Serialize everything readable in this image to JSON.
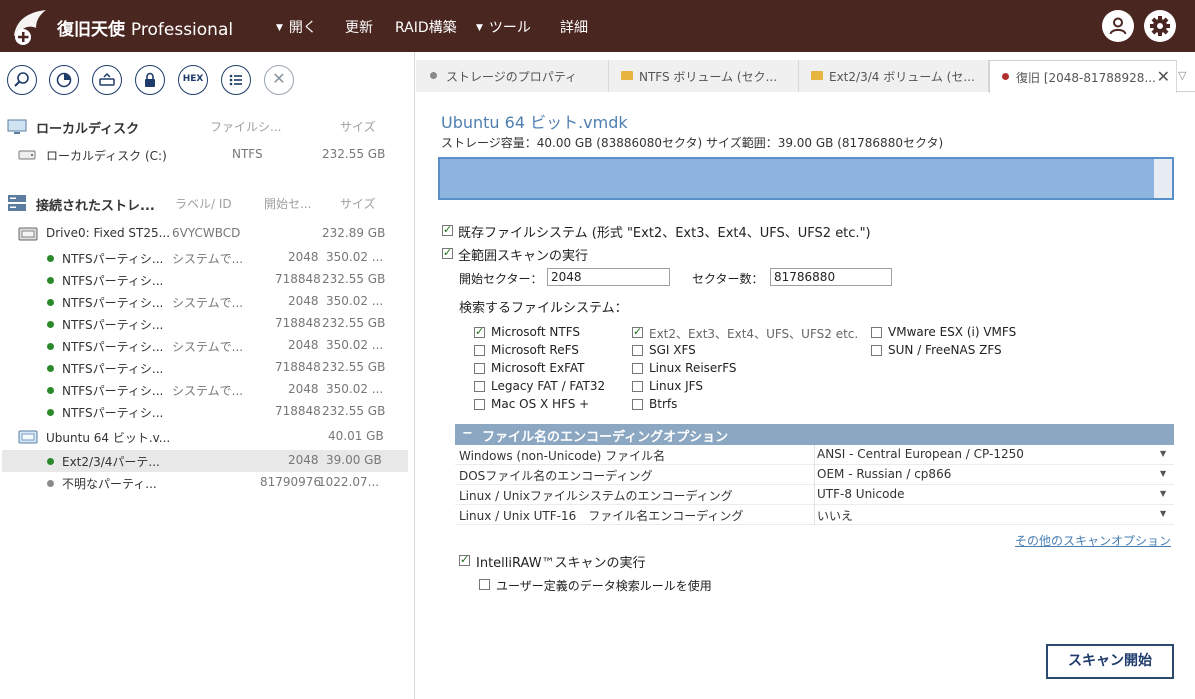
{
  "app": {
    "title_main": "復旧天使",
    "title_suffix": "Professional",
    "menu": [
      {
        "label": "開く",
        "caret": true
      },
      {
        "label": "更新",
        "caret": false
      },
      {
        "label": "RAID構築",
        "caret": false
      },
      {
        "label": "ツール",
        "caret": true
      },
      {
        "label": "詳細",
        "caret": false
      }
    ],
    "toolbar_hex": "HEX",
    "toolbar_close": "✕"
  },
  "left": {
    "local_section": {
      "title": "ローカルディスク",
      "col_fs": "ファイルシ...",
      "col_size": "サイズ"
    },
    "local_disk": {
      "name": "ローカルディスク (C:)",
      "fs": "NTFS",
      "size": "232.55 GB"
    },
    "connected_section": {
      "title": "接続されたストレ...",
      "col_label": "ラベル/ ID",
      "col_start": "開始セ...",
      "col_size": "サイズ"
    },
    "drive0": {
      "name": "Drive0: Fixed ST25...",
      "id": "6VYCWBCD",
      "size": "232.89 GB"
    },
    "partitions": [
      {
        "name": "NTFSパーティシ...",
        "label": "システムで...",
        "start": "2048",
        "size": "350.02 ..."
      },
      {
        "name": "NTFSパーティシ...",
        "label": "",
        "start": "718848",
        "size": "232.55 GB"
      },
      {
        "name": "NTFSパーティシ...",
        "label": "システムで...",
        "start": "2048",
        "size": "350.02 ..."
      },
      {
        "name": "NTFSパーティシ...",
        "label": "",
        "start": "718848",
        "size": "232.55 GB"
      },
      {
        "name": "NTFSパーティシ...",
        "label": "システムで...",
        "start": "2048",
        "size": "350.02 ..."
      },
      {
        "name": "NTFSパーティシ...",
        "label": "",
        "start": "718848",
        "size": "232.55 GB"
      },
      {
        "name": "NTFSパーティシ...",
        "label": "システムで...",
        "start": "2048",
        "size": "350.02 ..."
      },
      {
        "name": "NTFSパーティシ...",
        "label": "",
        "start": "718848",
        "size": "232.55 GB"
      }
    ],
    "vmdk": {
      "name": "Ubuntu 64 ビット.v...",
      "size": "40.01 GB"
    },
    "vmdk_parts": [
      {
        "name": "Ext2/3/4パーテ...",
        "start": "2048",
        "size": "39.00 GB"
      },
      {
        "name": "不明なパーティ...",
        "start": "81790976",
        "size": "1022.07..."
      }
    ]
  },
  "tabs": [
    {
      "label": "ストレージのプロパティ",
      "icon": "dot-icon"
    },
    {
      "label": "NTFS ボリューム (セク...",
      "icon": "folder-icon"
    },
    {
      "label": "Ext2/3/4 ボリューム (セ...",
      "icon": "folder-icon"
    },
    {
      "label": "復旧 [2048-81788928...",
      "icon": "red-dot-icon"
    }
  ],
  "tab_close": "✕",
  "tab_dropdown": "▽",
  "main": {
    "title": "Ubuntu 64 ビット.vmdk",
    "capacity": "ストレージ容量：40.00 GB (83886080セクタ) サイズ範囲：39.00 GB (81786880セクタ)",
    "range_fraction": 0.975,
    "existing_fs_label": "既存ファイルシステム (形式 \"Ext2、Ext3、Ext4、UFS、UFS2 etc.\")",
    "existing_fs_checked": true,
    "full_scan_label": "全範囲スキャンの実行",
    "full_scan_checked": true,
    "start_sector_label": "開始セクター：",
    "start_sector_value": "2048",
    "sector_count_label": "セクター数：",
    "sector_count_value": "81786880",
    "fs_search_label": "検索するファイルシステム：",
    "fs_options": [
      {
        "label": "Microsoft NTFS",
        "checked": true
      },
      {
        "label": "Microsoft ReFS",
        "checked": false
      },
      {
        "label": "Microsoft ExFAT",
        "checked": false
      },
      {
        "label": "Legacy FAT / FAT32",
        "checked": false
      },
      {
        "label": "Mac OS X HFS +",
        "checked": false
      },
      {
        "label": "Ext2、Ext3、Ext4、UFS、UFS2 etc.",
        "checked": true
      },
      {
        "label": "SGI XFS",
        "checked": false
      },
      {
        "label": "Linux ReiserFS",
        "checked": false
      },
      {
        "label": "Linux JFS",
        "checked": false
      },
      {
        "label": "Btrfs",
        "checked": false
      },
      {
        "label": "VMware ESX (i) VMFS",
        "checked": false
      },
      {
        "label": "SUN / FreeNAS ZFS",
        "checked": false
      }
    ],
    "encoding_header": "ファイル名のエンコーディングオプション",
    "encoding_collapse": "−",
    "encoding_rows": [
      {
        "key": "Windows (non-Unicode) ファイル名",
        "value": "ANSI - Central European / CP-1250"
      },
      {
        "key": "DOSファイル名のエンコーディング",
        "value": "OEM - Russian / cp866"
      },
      {
        "key": "Linux / Unixファイルシステムのエンコーディング",
        "value": "UTF-8 Unicode"
      },
      {
        "key": "Linux / Unix UTF-16　ファイル名エンコーディング",
        "value": "いいえ"
      }
    ],
    "more_options": "その他のスキャンオプション",
    "intelliraw_label": "IntelliRAW™スキャンの実行",
    "intelliraw_checked": true,
    "user_rules_label": "ユーザー定義のデータ検索ルールを使用",
    "user_rules_checked": false,
    "scan_button": "スキャン開始"
  }
}
